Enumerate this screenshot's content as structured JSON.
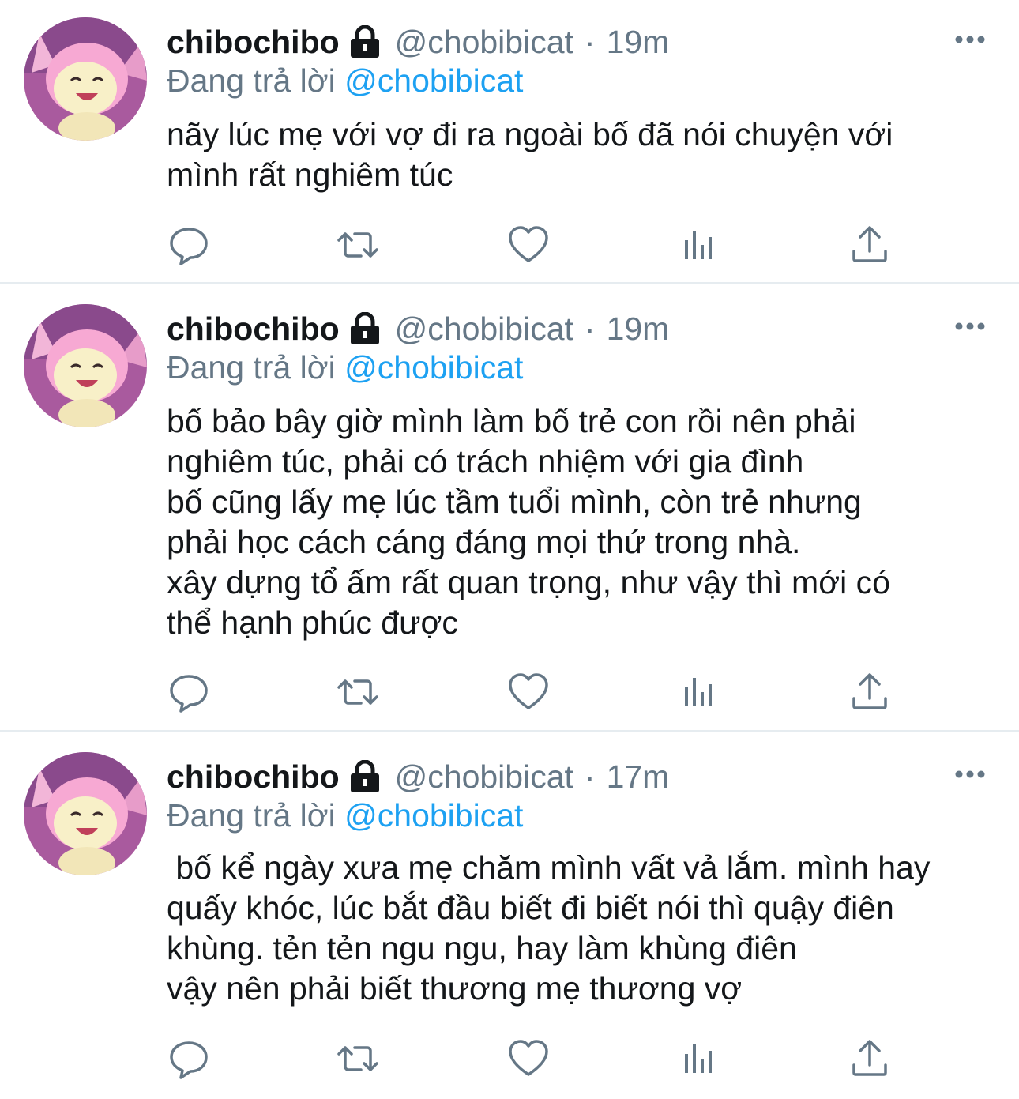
{
  "colors": {
    "text_primary": "#14171a",
    "text_secondary": "#657786",
    "link": "#1da1f2",
    "divider": "#e6ecf0",
    "icon": "#657786"
  },
  "icons": {
    "lock": "lock-icon",
    "more": "more-horizontal-icon",
    "reply": "reply-bubble-icon",
    "retweet": "retweet-icon",
    "like": "heart-icon",
    "analytics": "bar-chart-icon",
    "share": "share-upload-icon"
  },
  "tweets": [
    {
      "display_name": "chibochibo",
      "handle": "@chobibicat",
      "separator": "·",
      "time": "19m",
      "replying_label": "Đang trả lời",
      "replying_to": "@chobibicat",
      "text": "nãy lúc mẹ với vợ đi ra ngoài bố đã nói chuyện với\nmình rất nghiêm túc"
    },
    {
      "display_name": "chibochibo",
      "handle": "@chobibicat",
      "separator": "·",
      "time": "19m",
      "replying_label": "Đang trả lời",
      "replying_to": "@chobibicat",
      "text": "bố bảo bây giờ mình làm bố trẻ con rồi nên phải\nnghiêm túc, phải có trách nhiệm với gia đình\nbố cũng lấy mẹ lúc tầm tuổi mình, còn trẻ nhưng\nphải học cách cáng đáng mọi thứ trong nhà.\nxây dựng tổ ấm rất quan trọng, như vậy thì mới có\nthể hạnh phúc được"
    },
    {
      "display_name": "chibochibo",
      "handle": "@chobibicat",
      "separator": "·",
      "time": "17m",
      "replying_label": "Đang trả lời",
      "replying_to": "@chobibicat",
      "text": " bố kể ngày xưa mẹ chăm mình vất vả lắm. mình hay\nquấy khóc, lúc bắt đầu biết đi biết nói thì quậy điên\nkhùng. tẻn tẻn ngu ngu, hay làm khùng điên\nvậy nên phải biết thương mẹ thương vợ"
    }
  ]
}
